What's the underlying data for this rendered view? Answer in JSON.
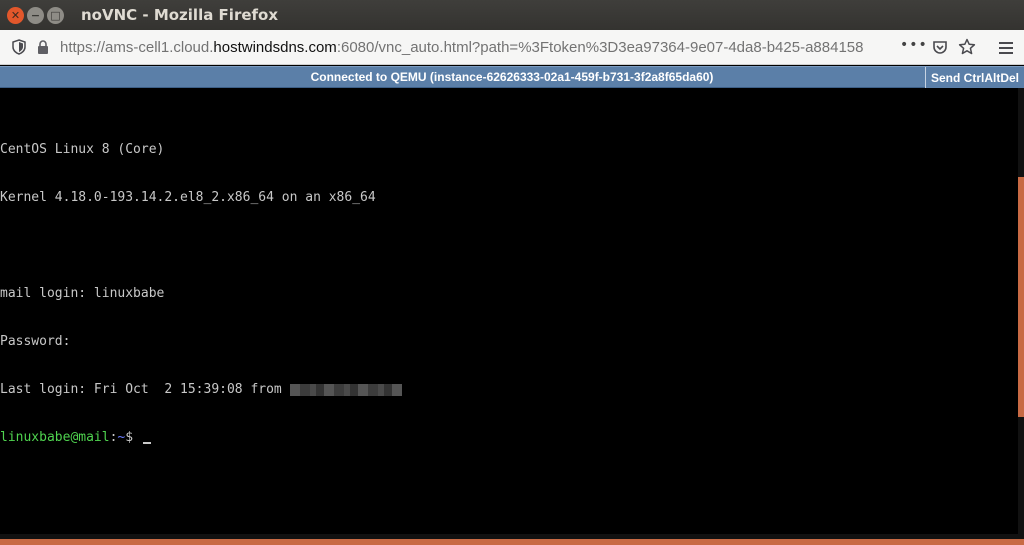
{
  "window": {
    "title": "noVNC - Mozilla Firefox"
  },
  "navbar": {
    "url_prefix": "https://ams-cell1.cloud.",
    "url_domain": "hostwindsdns.com",
    "url_suffix": ":6080/vnc_auto.html?path=%3Ftoken%3D3ea97364-9e07-4da8-b425-a884158",
    "more": "•••"
  },
  "vnc": {
    "status": "Connected to QEMU (instance-62626333-02a1-459f-b731-3f2a8f65da60)",
    "send_cad": "Send CtrlAltDel"
  },
  "console": {
    "line1": "CentOS Linux 8 (Core)",
    "line2": "Kernel 4.18.0-193.14.2.el8_2.x86_64 on an x86_64",
    "line3": "mail login: linuxbabe",
    "line4": "Password:",
    "line5": "Last login: Fri Oct  2 15:39:08 from ",
    "prompt_user": "linuxbabe@mail",
    "prompt_sep": ":",
    "prompt_dir": "~",
    "prompt_end": "$ "
  },
  "colors": {
    "vnc_bar": "#5b7fa8",
    "prompt_user": "#4fd34f",
    "scroll_thumb": "#c86a44"
  }
}
